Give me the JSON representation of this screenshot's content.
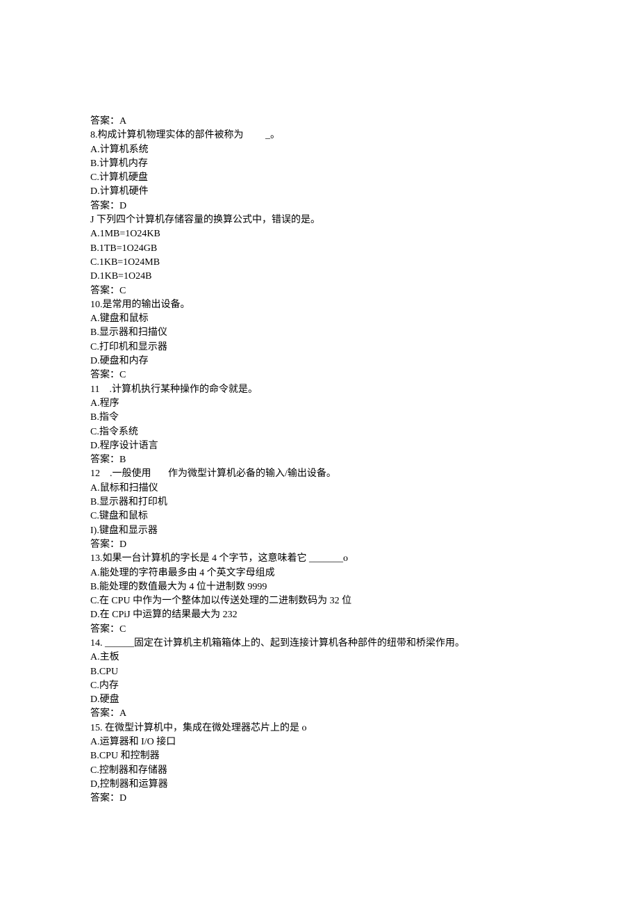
{
  "lines": [
    "答案：A",
    "8.构成计算机物理实体的部件被称为         _。",
    "A.计算机系统",
    "B.计算机内存",
    "C.计算机硬盘",
    "D.计算机硬件",
    "答案：D",
    "J 下列四个计算机存储容量的换算公式中，错误的是。",
    "A.1MB=1O24KB",
    "B.1TB=1O24GB",
    "C.1KB=1O24MB",
    "D.1KB=1O24B",
    "答案：C",
    "10.是常用的输出设备。",
    "A.键盘和鼠标",
    "B.显示器和扫描仪",
    "C.打印机和显示器",
    "D.硬盘和内存",
    "答案：C",
    "11    .计算机执行某种操作的命令就是。",
    "A.程序",
    "B.指令",
    "C.指令系统",
    "D.程序设计语言",
    "答案：B",
    "12    .一般使用       作为微型计算机必备的输入/输出设备。",
    "A.鼠标和扫描仪",
    "B.显示器和打印机",
    "C.键盘和鼠标",
    "I).键盘和显示器",
    "答案：D",
    "13.如果一台计算机的字长是 4 个字节，这意味着它 _______o",
    "A.能处理的字符串最多由 4 个英文字母组成",
    "B.能处理的数值最大为 4 位十进制数 9999",
    "C.在 CPU 中作为一个整体加以传送处理的二进制数码为 32 位",
    "D.在 CPiJ 中运算的结果最大为 232",
    "答案：C",
    "14. ______固定在计算机主机箱箱体上的、起到连接计算机各种部件的纽带和桥梁作用。",
    "A.主板",
    "B.CPU",
    "C.内存",
    "D.硬盘",
    "答案：A",
    "15. 在微型计算机中，集成在微处理器芯片上的是 o",
    "A.运算器和 I/O 接口",
    "B.CPU 和控制器",
    "C.控制器和存储器",
    "D,控制器和运算器",
    "答案：D"
  ]
}
